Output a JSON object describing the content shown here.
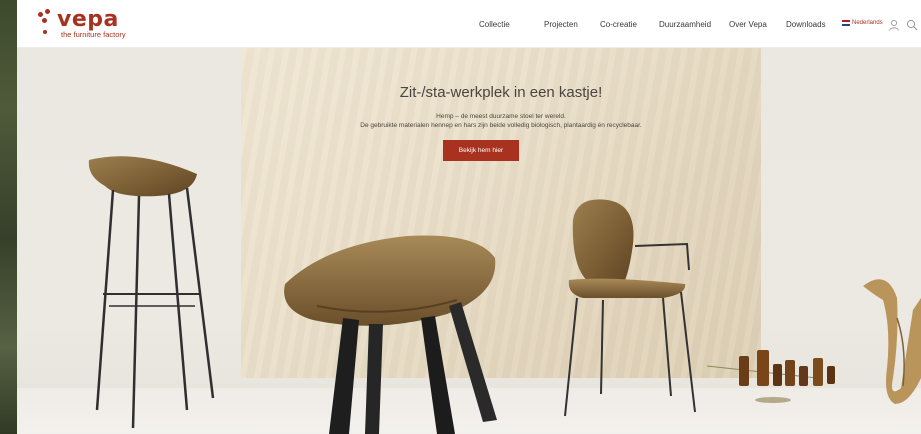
{
  "brand": {
    "name": "vepa",
    "tagline": "the furniture factory",
    "color": "#a8321f"
  },
  "nav": {
    "items": [
      {
        "label": "Collectie"
      },
      {
        "label": "Projecten"
      },
      {
        "label": "Co-creatie"
      },
      {
        "label": "Duurzaamheid"
      },
      {
        "label": "Over Vepa"
      },
      {
        "label": "Downloads"
      }
    ],
    "language": "Nederlands",
    "icons": [
      "user-icon",
      "search-icon"
    ]
  },
  "hero": {
    "title": "Zit-/sta-werkplek in een kastje!",
    "subtitle_line1": "Hemp – de meest duurzame stoel ter wereld.",
    "subtitle_line2": "De gebruikte materialen hennep en hars zijn beide volledig biologisch, plantaardig én recyclebaar.",
    "cta_label": "Bekijk hem hier"
  }
}
